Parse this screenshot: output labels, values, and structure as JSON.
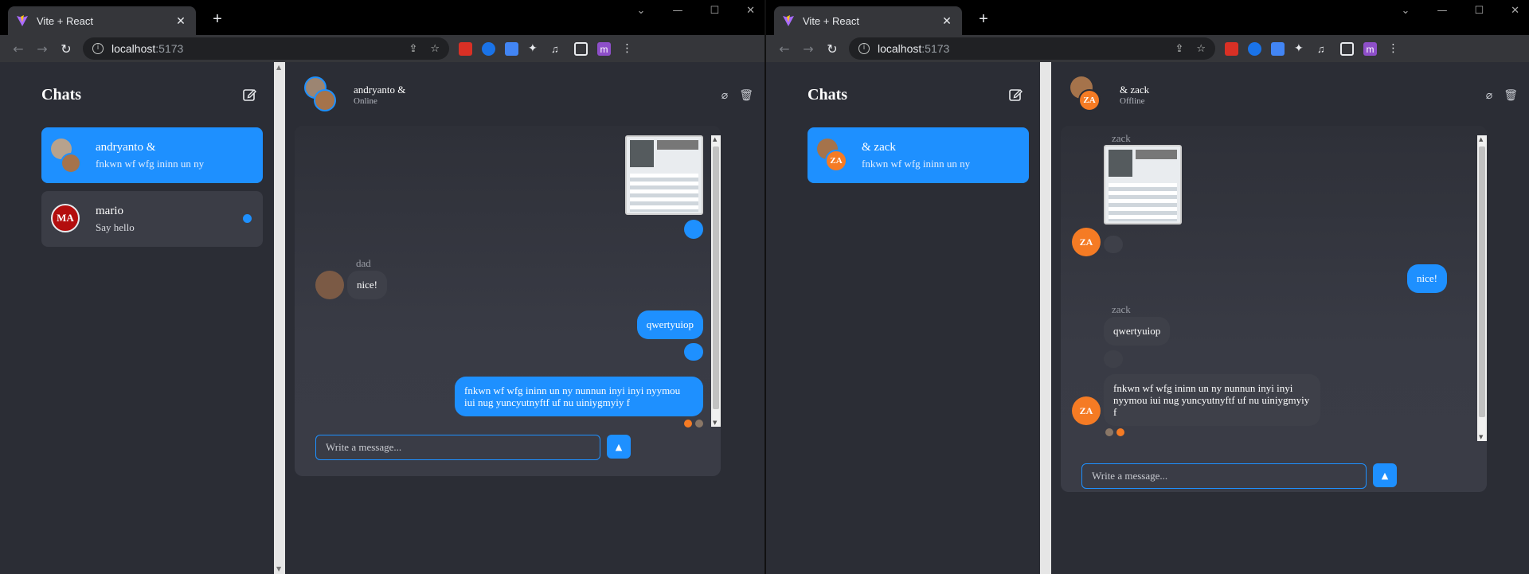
{
  "browser": {
    "tab_title": "Vite + React",
    "tab_close": "✕",
    "new_tab": "+",
    "url_host": "localhost",
    "url_port": ":5173",
    "profile_letter": "m",
    "icons": [
      "back-icon",
      "forward-icon",
      "reload-icon",
      "info-icon",
      "share-icon",
      "star-icon",
      "puzzle-icon",
      "sidebar-icon"
    ]
  },
  "left": {
    "sidebar": {
      "title": "Chats",
      "items": [
        {
          "name": "andryanto &",
          "preview": "fnkwn wf wfg ininn un ny",
          "active": true
        },
        {
          "name": "mario",
          "preview": "Say hello",
          "active": false,
          "avatar_initials": "MA",
          "unread": true
        }
      ]
    },
    "chat": {
      "name": "andryanto &",
      "status": "Online",
      "messages": [
        {
          "kind": "image-out"
        },
        {
          "sender": "dad",
          "text": "nice!",
          "kind": "in"
        },
        {
          "text": "qwertyuiop",
          "kind": "out"
        },
        {
          "text": "fnkwn wf wfg ininn un ny nunnun inyi inyi nyymou iui nug yuncyutnyftf uf nu uiniygmyiy f",
          "kind": "out"
        }
      ],
      "composer_placeholder": "Write a message..."
    }
  },
  "right": {
    "sidebar": {
      "title": "Chats",
      "items": [
        {
          "name": "& zack",
          "preview": "fnkwn wf wfg ininn un ny",
          "active": true,
          "avatar_initials": "ZA"
        }
      ]
    },
    "chat": {
      "name": "& zack",
      "status": "Offline",
      "avatar_initials": "ZA",
      "messages": [
        {
          "sender": "zack",
          "kind": "image-in"
        },
        {
          "text": "nice!",
          "kind": "out"
        },
        {
          "sender": "zack",
          "text": "qwertyuiop",
          "kind": "in"
        },
        {
          "text": "fnkwn wf wfg ininn un ny nunnun inyi inyi nyymou iui nug yuncyutnyftf uf nu uiniygmyiy f",
          "kind": "in"
        }
      ],
      "composer_placeholder": "Write a message..."
    }
  },
  "colors": {
    "accent": "#1e90ff",
    "orange_avatar": "#f57b24",
    "red_avatar": "#b30d0d"
  }
}
